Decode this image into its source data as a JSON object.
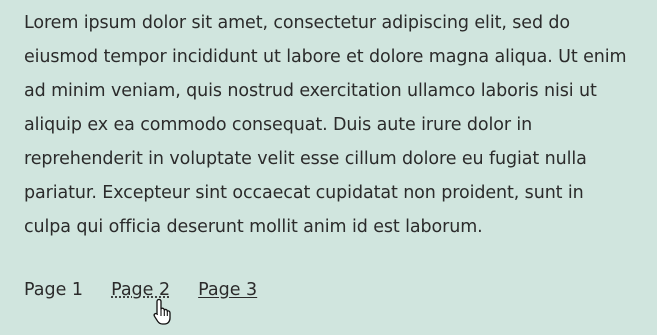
{
  "article": {
    "paragraph": "Lorem ipsum dolor sit amet, consectetur adipiscing elit, sed do eiusmod tempor incididunt ut labore et dolore magna aliqua. Ut enim ad minim veniam, quis nostrud exercitation ullamco laboris nisi ut aliquip ex ea commodo consequat. Duis aute irure dolor in reprehenderit in voluptate velit esse cillum dolore eu fugiat nulla pariatur. Excepteur sint occaecat cupidatat non proident, sunt in culpa qui officia deserunt mollit anim id est laborum."
  },
  "pagination": {
    "items": [
      {
        "label": "Page 1",
        "state": "current"
      },
      {
        "label": "Page 2",
        "state": "hovered"
      },
      {
        "label": "Page 3",
        "state": "link"
      }
    ]
  },
  "cursor": {
    "icon": "hand-pointer-icon"
  },
  "colors": {
    "background": "#d0e5de",
    "text": "#2b2b2b"
  }
}
